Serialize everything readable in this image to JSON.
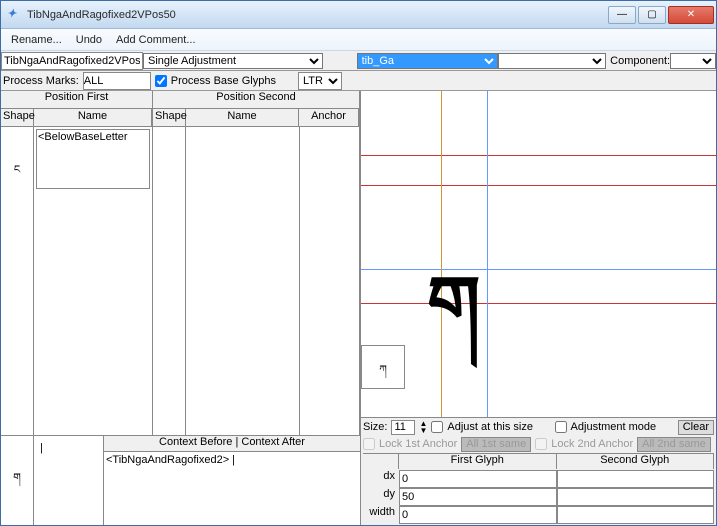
{
  "window": {
    "title": "TibNgaAndRagofixed2VPos50"
  },
  "menu": {
    "rename": "Rename...",
    "undo": "Undo",
    "addComment": "Add Comment..."
  },
  "toolbar": {
    "lookupName": "TibNgaAndRagofixed2VPos",
    "lookupType": "Single Adjustment",
    "glyphSel": "tib_Ga",
    "componentLabel": "Component:",
    "processMarksLabel": "Process Marks:",
    "processMarksValue": "ALL",
    "processBaseLabel": "Process Base Glyphs",
    "direction": "LTR"
  },
  "tables": {
    "posFirst": {
      "title": "Position First",
      "colShape": "Shape",
      "colName": "Name",
      "names": [
        "<BelowBaseLetter"
      ]
    },
    "posSecond": {
      "title": "Position Second",
      "colShape": "Shape",
      "colName": "Name",
      "colAnchor": "Anchor"
    }
  },
  "context": {
    "title": "Context Before | Context After",
    "value": "<TibNgaAndRagofixed2> |"
  },
  "glyphCtrls": {
    "sizeLabel": "Size:",
    "sizeValue": "11",
    "adjustAtSize": "Adjust at this size",
    "adjustmentMode": "Adjustment mode",
    "clear": "Clear",
    "lock1st": "Lock 1st Anchor",
    "all1st": "All 1st same",
    "lock2nd": "Lock 2nd Anchor",
    "all2nd": "All 2nd same",
    "firstGlyph": "First Glyph",
    "secondGlyph": "Second Glyph",
    "dxLabel": "dx",
    "dxVal": "0",
    "dyLabel": "dy",
    "dyVal": "50",
    "widthLabel": "width",
    "widthVal": "0"
  },
  "glyphs": {
    "shape1": "ང",
    "shape2": "|",
    "main": "ག",
    "preview": "ཀ"
  }
}
